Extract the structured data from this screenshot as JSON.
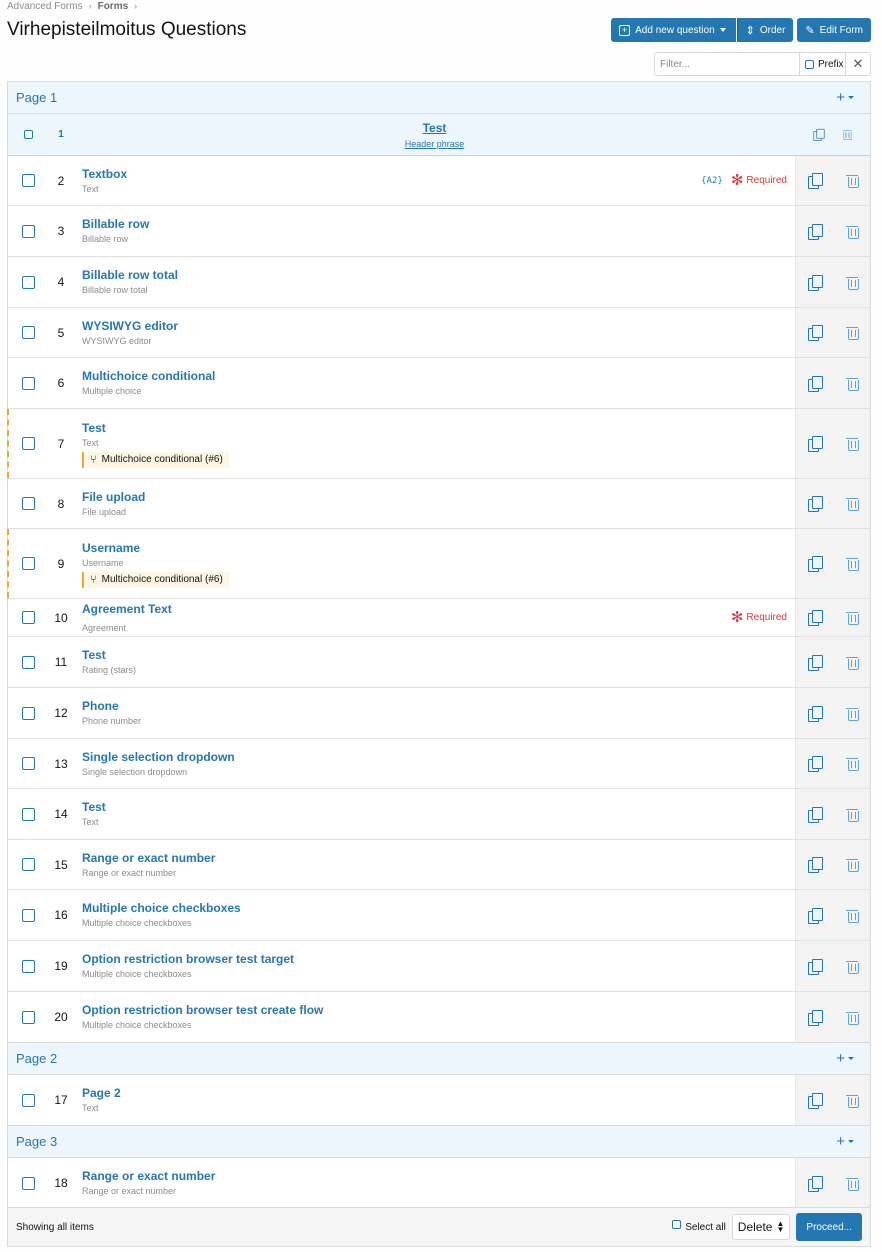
{
  "breadcrumb": [
    "Advanced Forms",
    "Forms"
  ],
  "page_title": "Virhepisteilmoitus Questions",
  "toolbar": {
    "add_label": "Add new question",
    "order_label": "Order",
    "edit_label": "Edit Form"
  },
  "filter": {
    "placeholder": "Filter...",
    "prefix_label": "Prefix",
    "clear_icon": "close-icon"
  },
  "pages": [
    {
      "label": "Page 1",
      "header_row": {
        "num": "1",
        "title": "Test",
        "subtitle": "Header phrase"
      },
      "rows": [
        {
          "num": "2",
          "title": "Textbox",
          "type": "Text",
          "tag": "{A2}",
          "required": "Required"
        },
        {
          "num": "3",
          "title": "Billable row",
          "type": "Billable row"
        },
        {
          "num": "4",
          "title": "Billable row total",
          "type": "Billable row total"
        },
        {
          "num": "5",
          "title": "WYSIWYG editor",
          "type": "WYSIWYG editor"
        },
        {
          "num": "6",
          "title": "Multichoice conditional",
          "type": "Multiple choice"
        },
        {
          "num": "7",
          "title": "Test",
          "type": "Text",
          "condition": "Multichoice conditional (#6)"
        },
        {
          "num": "8",
          "title": "File upload",
          "type": "File upload"
        },
        {
          "num": "9",
          "title": "Username",
          "type": "Username",
          "condition": "Multichoice conditional (#6)"
        },
        {
          "num": "10",
          "title": "Agreement Text",
          "type": "Agreement",
          "required": "Required",
          "centered": true
        },
        {
          "num": "11",
          "title": "Test",
          "type": "Rating (stars)"
        },
        {
          "num": "12",
          "title": "Phone",
          "type": "Phone number"
        },
        {
          "num": "13",
          "title": "Single selection dropdown",
          "type": "Single selection dropdown"
        },
        {
          "num": "14",
          "title": "Test",
          "type": "Text"
        },
        {
          "num": "15",
          "title": "Range or exact number",
          "type": "Range or exact number"
        },
        {
          "num": "16",
          "title": "Multiple choice checkboxes",
          "type": "Multiple choice checkboxes"
        },
        {
          "num": "19",
          "title": "Option restriction browser test target",
          "type": "Multiple choice checkboxes"
        },
        {
          "num": "20",
          "title": "Option restriction browser test create flow",
          "type": "Multiple choice checkboxes"
        }
      ]
    },
    {
      "label": "Page 2",
      "rows": [
        {
          "num": "17",
          "title": "Page 2",
          "type": "Text"
        }
      ]
    },
    {
      "label": "Page 3",
      "rows": [
        {
          "num": "18",
          "title": "Range or exact number",
          "type": "Range or exact number"
        }
      ]
    }
  ],
  "footer": {
    "status": "Showing all items",
    "select_all_label": "Select all",
    "action_value": "Delete",
    "proceed_label": "Proceed..."
  },
  "colors": {
    "accent": "#2577b1",
    "page_header_bg": "#edf6fd",
    "required": "#d63a3a",
    "condition_marker": "#f0a830"
  }
}
